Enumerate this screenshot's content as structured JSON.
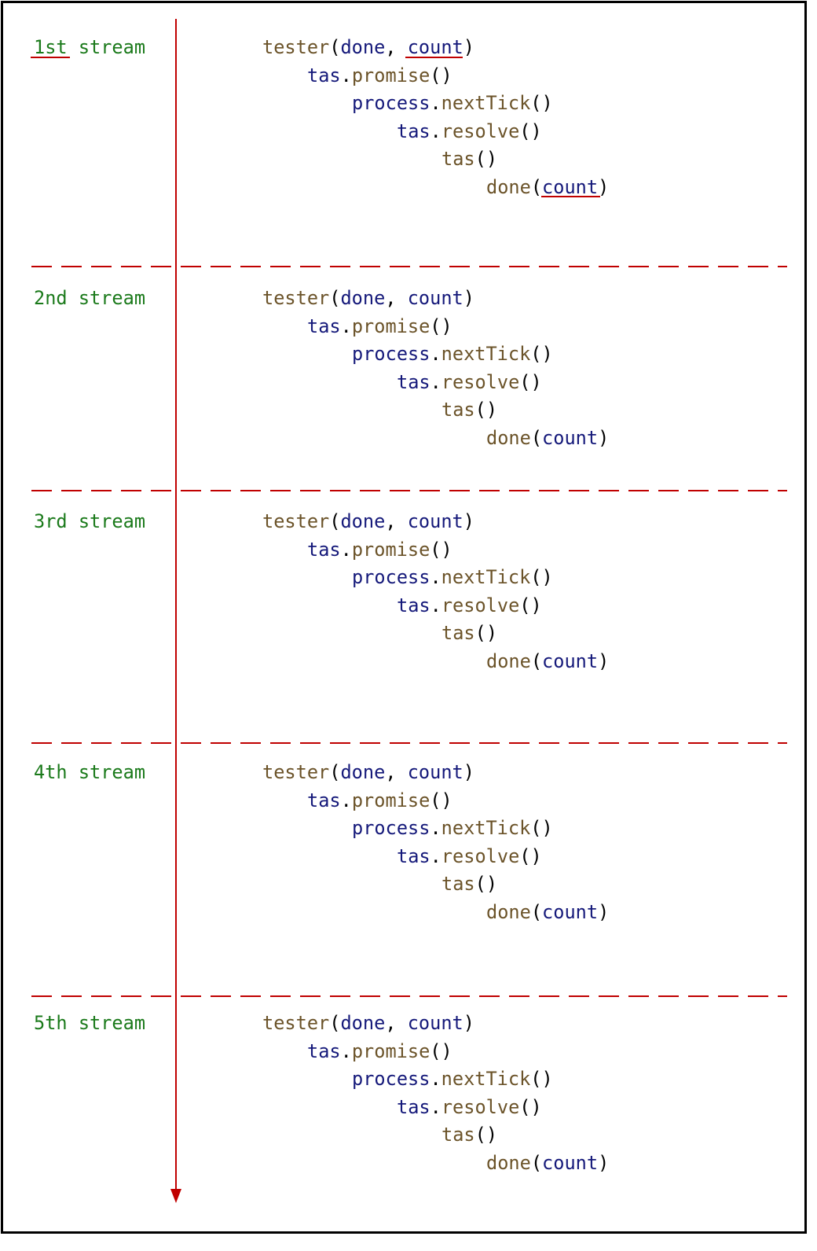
{
  "colors": {
    "label": "#1b7a1b",
    "function": "#6b5329",
    "identifier": "#15197a",
    "punctuation": "#000000",
    "timeline": "#c00000",
    "frame": "#000000"
  },
  "streams": [
    {
      "label": "1st stream",
      "code": {
        "tester": "tester",
        "open1": "(",
        "done_arg": "done",
        "comma": ",",
        "count_arg": "count",
        "close1": ")",
        "tas1": "tas",
        "dot1": ".",
        "promise": "promise",
        "parens1": "()",
        "process": "process",
        "dot2": ".",
        "nextTick": "nextTick",
        "parens2": "()",
        "tas2": "tas",
        "dot3": ".",
        "resolve": "resolve",
        "parens3": "()",
        "tas3": "tas",
        "parens4": "()",
        "done_call": "done",
        "open2": "(",
        "count_call": "count",
        "close2": ")"
      }
    },
    {
      "label": "2nd stream",
      "code": {
        "tester": "tester",
        "open1": "(",
        "done_arg": "done",
        "comma": ",",
        "count_arg": "count",
        "close1": ")",
        "tas1": "tas",
        "dot1": ".",
        "promise": "promise",
        "parens1": "()",
        "process": "process",
        "dot2": ".",
        "nextTick": "nextTick",
        "parens2": "()",
        "tas2": "tas",
        "dot3": ".",
        "resolve": "resolve",
        "parens3": "()",
        "tas3": "tas",
        "parens4": "()",
        "done_call": "done",
        "open2": "(",
        "count_call": "count",
        "close2": ")"
      }
    },
    {
      "label": "3rd stream",
      "code": {
        "tester": "tester",
        "open1": "(",
        "done_arg": "done",
        "comma": ",",
        "count_arg": "count",
        "close1": ")",
        "tas1": "tas",
        "dot1": ".",
        "promise": "promise",
        "parens1": "()",
        "process": "process",
        "dot2": ".",
        "nextTick": "nextTick",
        "parens2": "()",
        "tas2": "tas",
        "dot3": ".",
        "resolve": "resolve",
        "parens3": "()",
        "tas3": "tas",
        "parens4": "()",
        "done_call": "done",
        "open2": "(",
        "count_call": "count",
        "close2": ")"
      }
    },
    {
      "label": "4th stream",
      "code": {
        "tester": "tester",
        "open1": "(",
        "done_arg": "done",
        "comma": ",",
        "count_arg": "count",
        "close1": ")",
        "tas1": "tas",
        "dot1": ".",
        "promise": "promise",
        "parens1": "()",
        "process": "process",
        "dot2": ".",
        "nextTick": "nextTick",
        "parens2": "()",
        "tas2": "tas",
        "dot3": ".",
        "resolve": "resolve",
        "parens3": "()",
        "tas3": "tas",
        "parens4": "()",
        "done_call": "done",
        "open2": "(",
        "count_call": "count",
        "close2": ")"
      }
    },
    {
      "label": "5th stream",
      "code": {
        "tester": "tester",
        "open1": "(",
        "done_arg": "done",
        "comma": ",",
        "count_arg": "count",
        "close1": ")",
        "tas1": "tas",
        "dot1": ".",
        "promise": "promise",
        "parens1": "()",
        "process": "process",
        "dot2": ".",
        "nextTick": "nextTick",
        "parens2": "()",
        "tas2": "tas",
        "dot3": ".",
        "resolve": "resolve",
        "parens3": "()",
        "tas3": "tas",
        "parens4": "()",
        "done_call": "done",
        "open2": "(",
        "count_call": "count",
        "close2": ")"
      }
    }
  ]
}
